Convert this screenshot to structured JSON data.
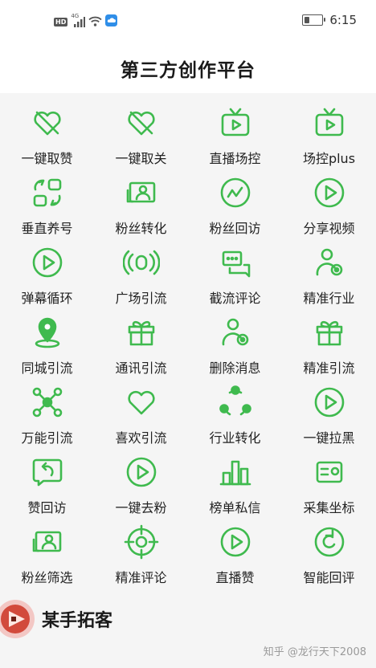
{
  "status_bar": {
    "hd": "HD",
    "network": "4G",
    "time": "6:15",
    "battery_level": 0.3
  },
  "header": {
    "title": "第三方创作平台"
  },
  "accent_color": "#3fba4e",
  "grid": [
    {
      "label": "一键取赞",
      "icon": "heart-crossed-icon"
    },
    {
      "label": "一键取关",
      "icon": "heart-crossed-icon"
    },
    {
      "label": "直播场控",
      "icon": "tv-play-icon"
    },
    {
      "label": "场控plus",
      "icon": "tv-play-icon"
    },
    {
      "label": "垂直养号",
      "icon": "swap-grid-icon"
    },
    {
      "label": "粉丝转化",
      "icon": "user-card-icon"
    },
    {
      "label": "粉丝回访",
      "icon": "trend-circle-icon"
    },
    {
      "label": "分享视频",
      "icon": "play-circle-icon"
    },
    {
      "label": "弹幕循环",
      "icon": "play-circle-icon"
    },
    {
      "label": "广场引流",
      "icon": "broadcast-icon"
    },
    {
      "label": "截流评论",
      "icon": "chat-icon"
    },
    {
      "label": "精准行业",
      "icon": "user-gear-icon"
    },
    {
      "label": "同城引流",
      "icon": "map-pin-icon"
    },
    {
      "label": "通讯引流",
      "icon": "gift-icon"
    },
    {
      "label": "删除消息",
      "icon": "user-gear-icon"
    },
    {
      "label": "精准引流",
      "icon": "gift-icon"
    },
    {
      "label": "万能引流",
      "icon": "network-icon"
    },
    {
      "label": "喜欢引流",
      "icon": "heart-icon"
    },
    {
      "label": "行业转化",
      "icon": "share-circle-icon"
    },
    {
      "label": "一键拉黑",
      "icon": "play-circle-icon"
    },
    {
      "label": "赞回访",
      "icon": "return-chat-icon"
    },
    {
      "label": "一键去粉",
      "icon": "play-circle-icon"
    },
    {
      "label": "榜单私信",
      "icon": "bar-chart-icon"
    },
    {
      "label": "采集坐标",
      "icon": "id-card-icon"
    },
    {
      "label": "粉丝筛选",
      "icon": "user-card-icon"
    },
    {
      "label": "精准评论",
      "icon": "target-icon"
    },
    {
      "label": "直播赞",
      "icon": "play-circle-icon"
    },
    {
      "label": "智能回评",
      "icon": "refresh-circle-icon"
    }
  ],
  "footer": {
    "app_name": "某手拓客",
    "watermark": "知乎 @龙行天下2008"
  }
}
